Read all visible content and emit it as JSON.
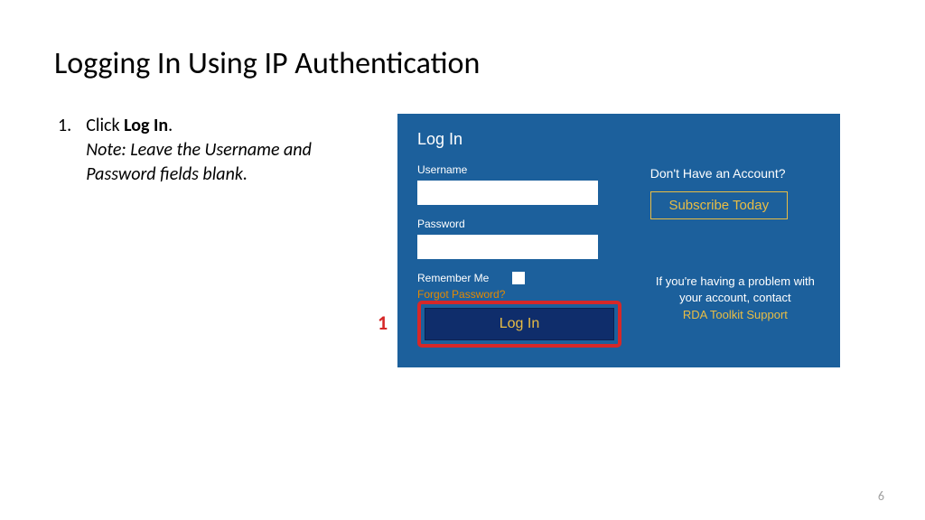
{
  "slide": {
    "title": "Logging In Using IP Authentication",
    "page_number": "6"
  },
  "instructions": {
    "number": "1.",
    "action_prefix": "Click ",
    "action_bold": "Log In",
    "action_suffix": ".",
    "note": "Note: Leave the Username and Password fields blank."
  },
  "callout": {
    "marker": "1"
  },
  "panel": {
    "heading": "Log In",
    "username_label": "Username",
    "username_value": "",
    "password_label": "Password",
    "password_value": "",
    "remember_label": "Remember Me",
    "forgot_label": "Forgot Password?",
    "login_button": "Log In",
    "no_account": "Don't Have an Account?",
    "subscribe_button": "Subscribe Today",
    "problem_text": "If you're having a problem with your account, contact",
    "support_link": "RDA Toolkit Support"
  }
}
